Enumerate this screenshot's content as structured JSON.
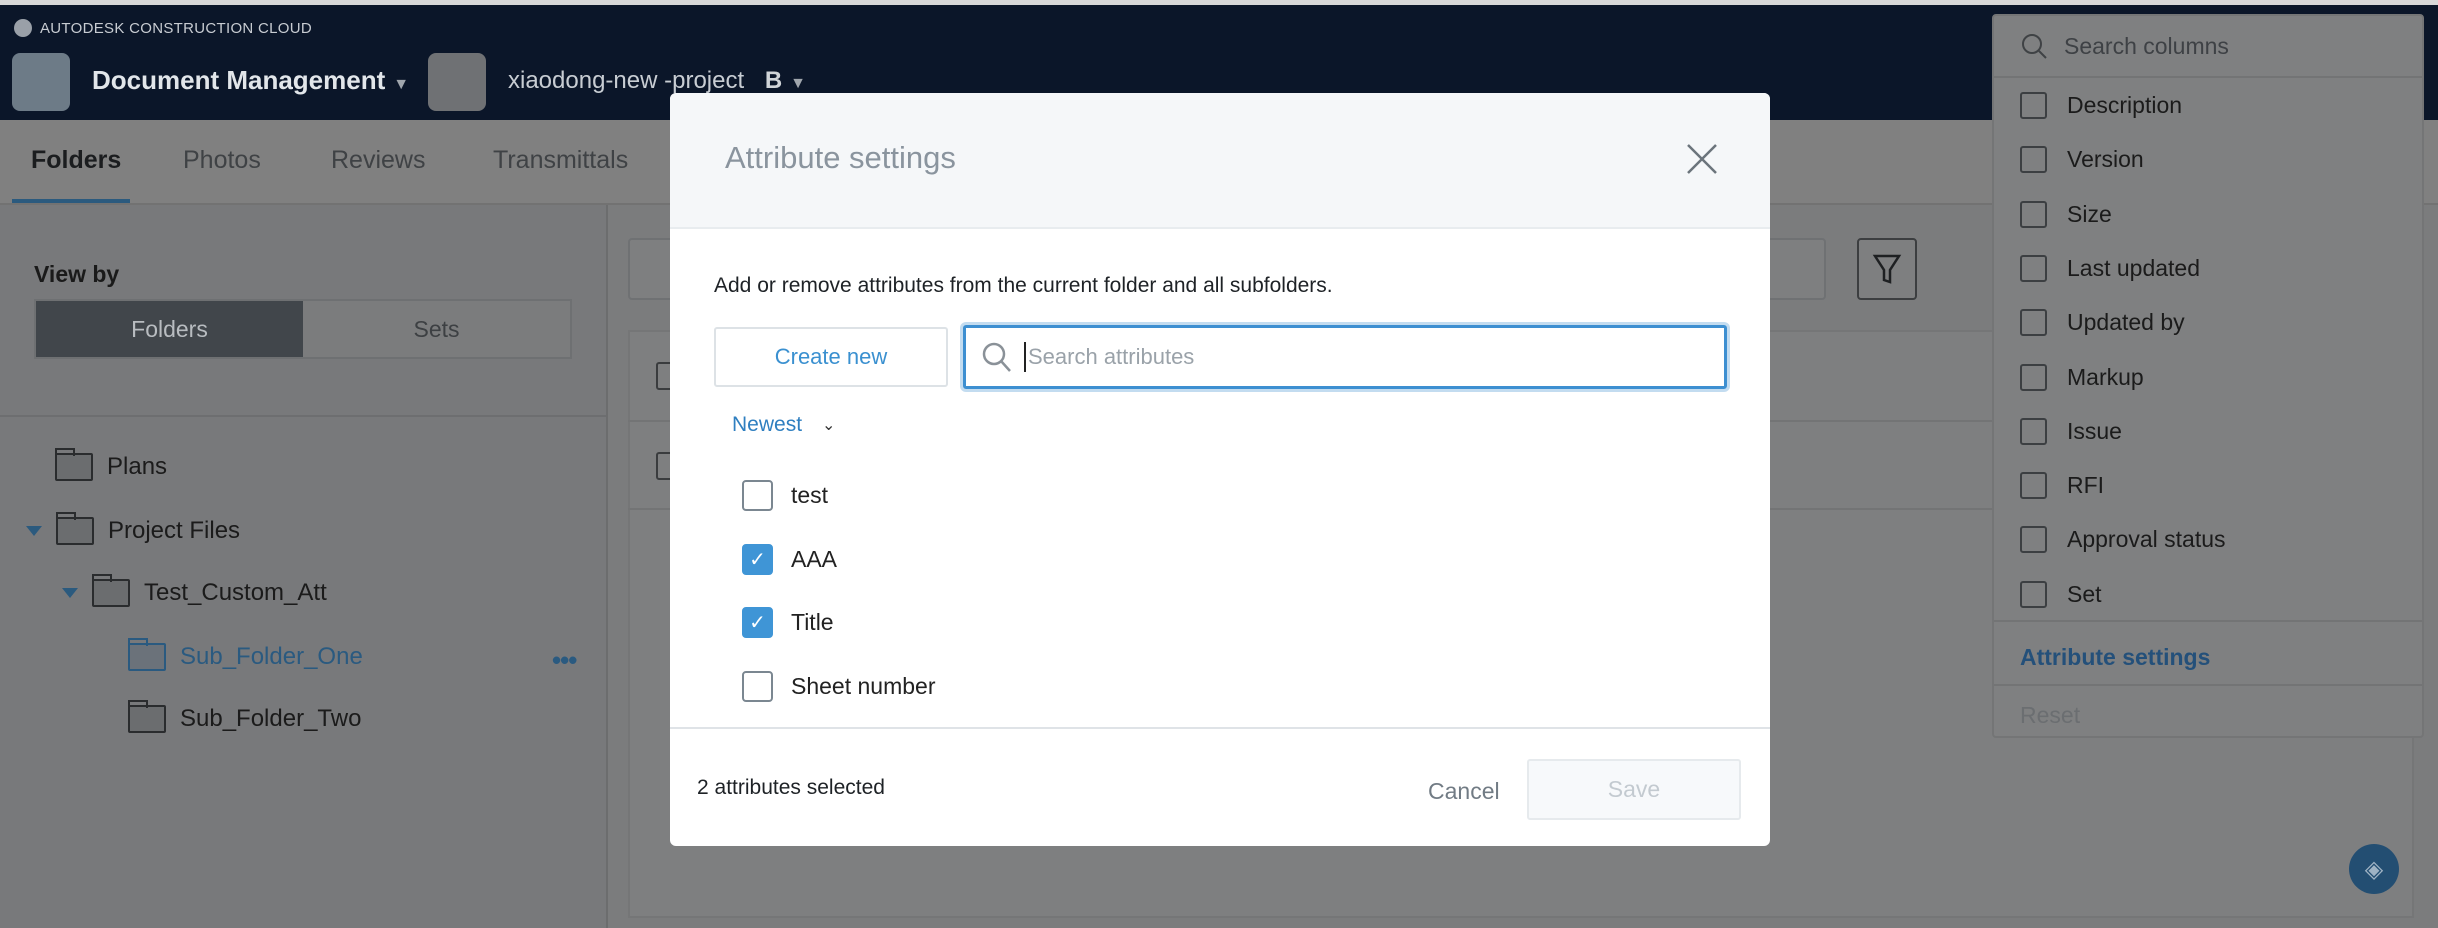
{
  "topnav": {
    "brand": "AUTODESK CONSTRUCTION CLOUD",
    "app_name": "Document Management",
    "project_name": "xiaodong-new -project",
    "project_badge": "B"
  },
  "tabs": [
    {
      "label": "Folders",
      "active": true
    },
    {
      "label": "Photos"
    },
    {
      "label": "Reviews"
    },
    {
      "label": "Transmittals"
    }
  ],
  "sidebar": {
    "view_by_label": "View by",
    "toggle": {
      "folders": "Folders",
      "sets": "Sets",
      "selected": "Folders"
    },
    "tree": [
      {
        "label": "Plans"
      },
      {
        "label": "Project Files",
        "expanded": true
      },
      {
        "label": "Test_Custom_Att",
        "expanded": true
      },
      {
        "label": "Sub_Folder_One",
        "selected": true
      },
      {
        "label": "Sub_Folder_Two"
      }
    ]
  },
  "columns_panel": {
    "search_placeholder": "Search columns",
    "items": [
      {
        "label": "Description",
        "checked": false
      },
      {
        "label": "Version",
        "checked": false
      },
      {
        "label": "Size",
        "checked": false
      },
      {
        "label": "Last updated",
        "checked": false
      },
      {
        "label": "Updated by",
        "checked": false
      },
      {
        "label": "Markup",
        "checked": false
      },
      {
        "label": "Issue",
        "checked": false
      },
      {
        "label": "RFI",
        "checked": false
      },
      {
        "label": "Approval status",
        "checked": false
      },
      {
        "label": "Set",
        "checked": false
      }
    ],
    "attribute_settings": "Attribute settings",
    "reset": "Reset"
  },
  "modal": {
    "title": "Attribute settings",
    "description": "Add or remove attributes from the current folder and all subfolders.",
    "create_new": "Create new",
    "search_placeholder": "Search attributes",
    "sort": "Newest",
    "attributes": [
      {
        "label": "test",
        "checked": false
      },
      {
        "label": "AAA",
        "checked": true
      },
      {
        "label": "Title",
        "checked": true
      },
      {
        "label": "Sheet number",
        "checked": false
      }
    ],
    "selected_count": "2 attributes selected",
    "cancel": "Cancel",
    "save": "Save"
  },
  "colors": {
    "accent": "#3f95d6",
    "nav_bg": "#0b1629",
    "link": "#2f7fc0"
  }
}
